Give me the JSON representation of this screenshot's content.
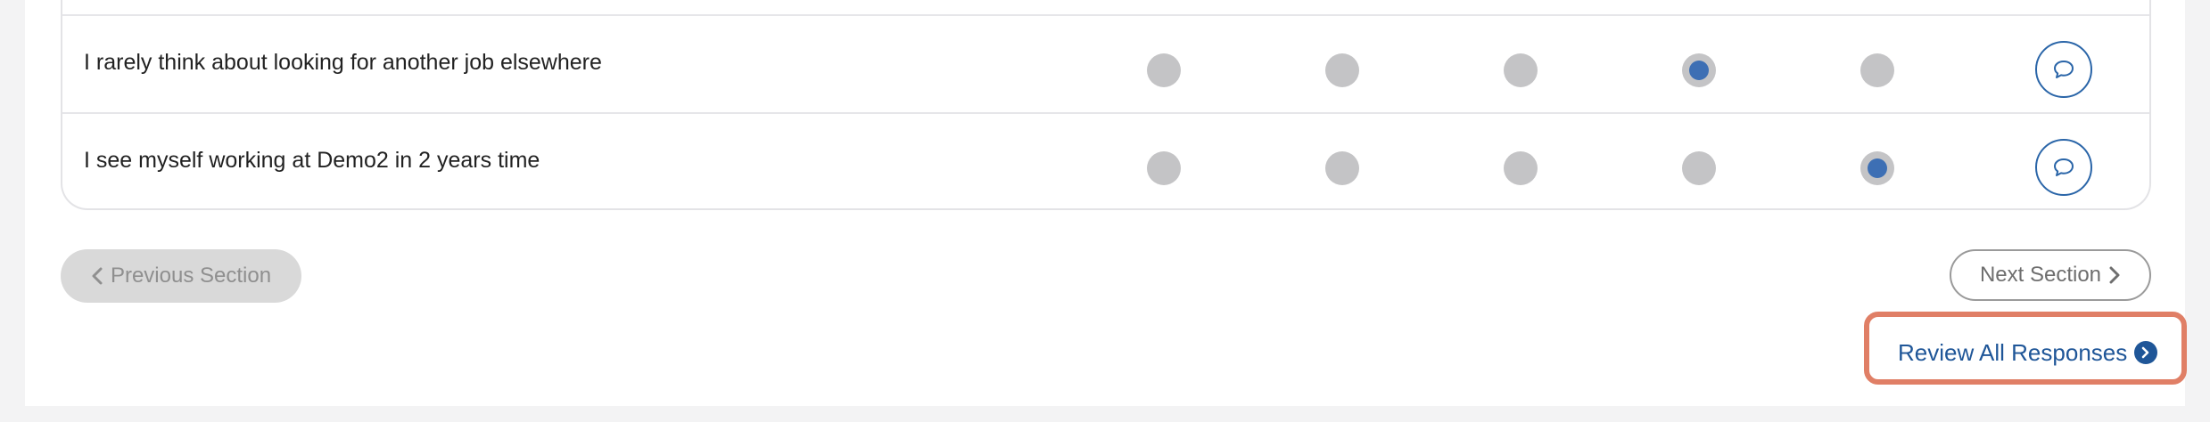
{
  "questions": [
    {
      "text": "I rarely think about looking for another job elsewhere",
      "selected_option": 4
    },
    {
      "text": "I see myself working at Demo2 in 2 years time",
      "selected_option": 5
    }
  ],
  "options_count": 5,
  "navigation": {
    "previous_label": "Previous Section",
    "next_label": "Next Section",
    "review_label": "Review All Responses"
  },
  "icons": {
    "comment": "comment-icon",
    "chevron_left": "chevron-left-icon",
    "chevron_right": "chevron-right-icon",
    "chevron_circle_right": "chevron-circle-right-icon"
  },
  "colors": {
    "accent": "#3d6fb4",
    "link": "#1f5698",
    "radio_unselected": "#c4c4c6",
    "highlight": "#e07f66"
  }
}
